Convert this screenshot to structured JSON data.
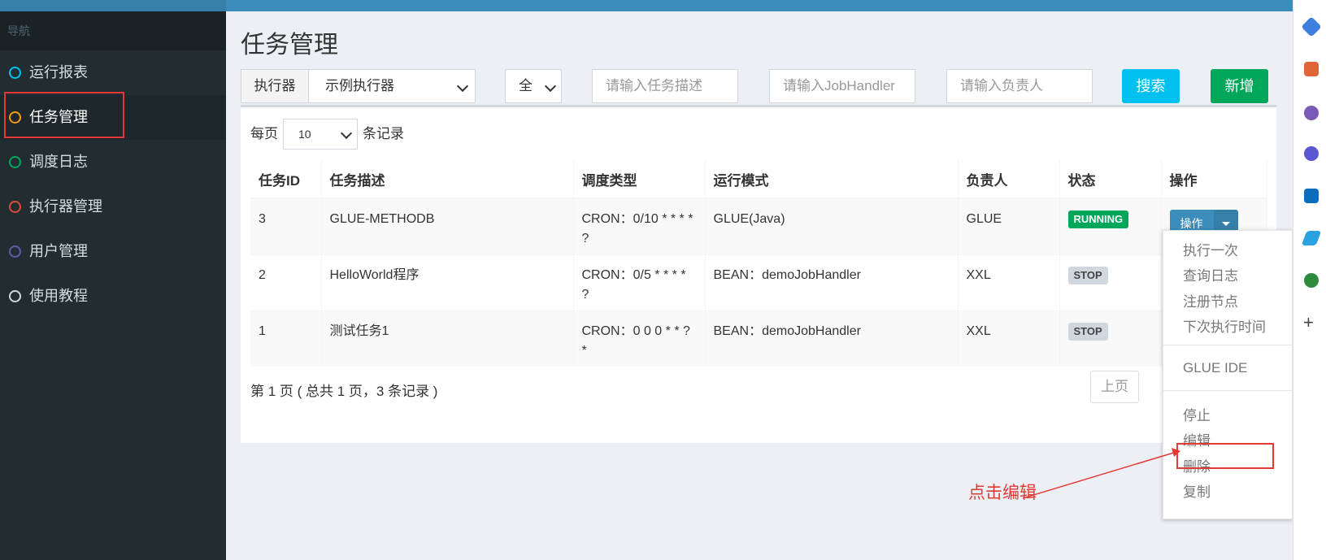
{
  "sidebar": {
    "header": "导航",
    "items": [
      {
        "label": "运行报表",
        "color": "#00c0ef"
      },
      {
        "label": "任务管理",
        "color": "#f39c12"
      },
      {
        "label": "调度日志",
        "color": "#00a65a"
      },
      {
        "label": "执行器管理",
        "color": "#dd4b39"
      },
      {
        "label": "用户管理",
        "color": "#605ca8"
      },
      {
        "label": "使用教程",
        "color": "#d2d6de"
      }
    ]
  },
  "page": {
    "title": "任务管理"
  },
  "filters": {
    "executor_label": "执行器",
    "executor_value": "示例执行器",
    "status_value": "全",
    "desc_placeholder": "请输入任务描述",
    "handler_placeholder": "请输入JobHandler",
    "author_placeholder": "请输入负责人",
    "search_label": "搜索",
    "add_label": "新增"
  },
  "table": {
    "perpage_before": "每页",
    "perpage_value": "10",
    "perpage_after": "条记录",
    "headers": [
      "任务ID",
      "任务描述",
      "调度类型",
      "运行模式",
      "负责人",
      "状态",
      "操作"
    ],
    "rows": [
      {
        "id": "3",
        "desc": "GLUE-METHODB",
        "cron": "CRON：0/10 * * * * ?",
        "mode": "GLUE(Java)",
        "author": "GLUE",
        "status": "RUNNING"
      },
      {
        "id": "2",
        "desc": "HelloWorld程序",
        "cron": "CRON：0/5 * * * * ?",
        "mode": "BEAN：demoJobHandler",
        "author": "XXL",
        "status": "STOP"
      },
      {
        "id": "1",
        "desc": "测试任务1",
        "cron": "CRON：0 0 0 * * ? *",
        "mode": "BEAN：demoJobHandler",
        "author": "XXL",
        "status": "STOP"
      }
    ],
    "op_label": "操作",
    "pager_info": "第 1 页 ( 总共 1 页，3 条记录 )",
    "pager_prev": "上页"
  },
  "dropdown": {
    "group1": [
      "执行一次",
      "查询日志",
      "注册节点",
      "下次执行时间"
    ],
    "group2": [
      "GLUE IDE"
    ],
    "group3": [
      "停止",
      "编辑",
      "删除",
      "复制"
    ]
  },
  "annotation": {
    "text": "点击编辑",
    "color": "#e53935"
  }
}
